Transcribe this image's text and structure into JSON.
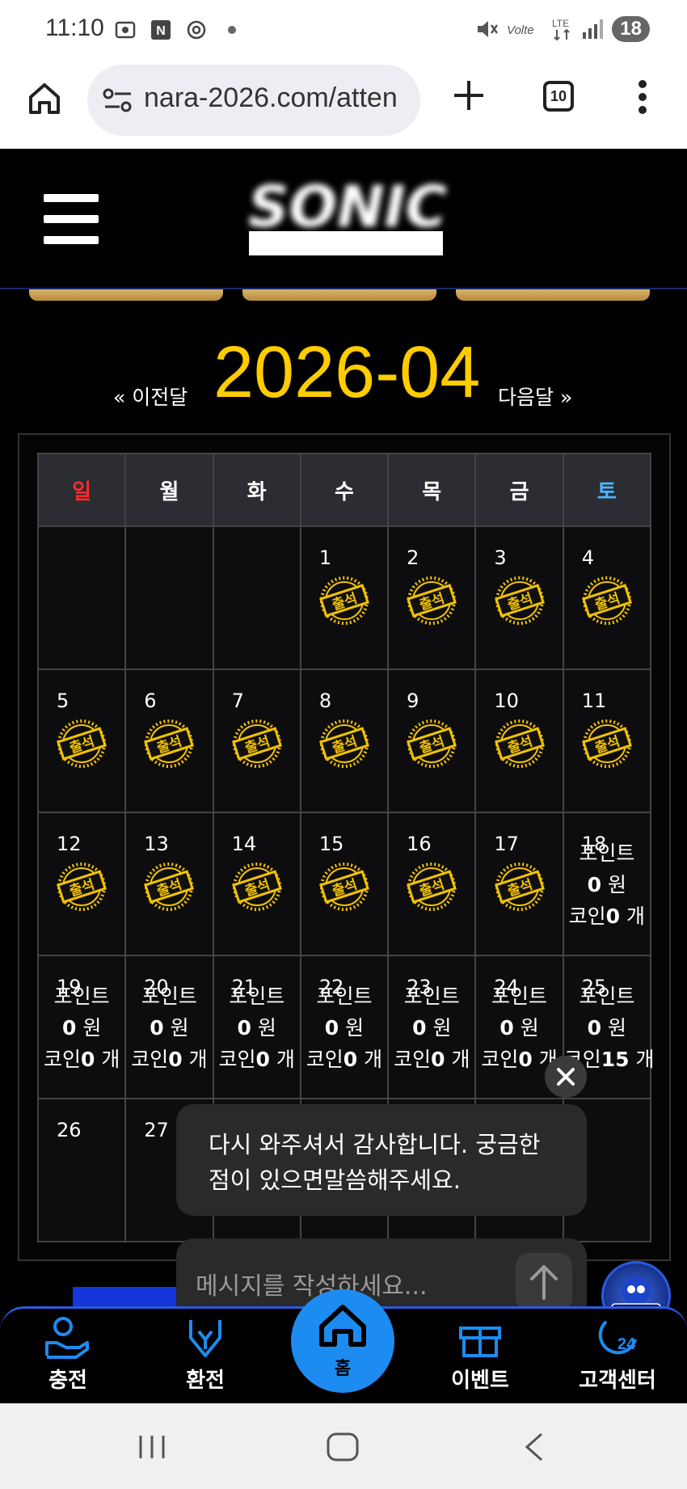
{
  "status_bar": {
    "time": "11:10",
    "battery": "18",
    "network": "LTE"
  },
  "browser": {
    "url": "nara-2026.com/atten",
    "tab_count": "10"
  },
  "calendar": {
    "prev_label": "« 이전달",
    "next_label": "다음달 »",
    "month": "2026-04",
    "weekdays": [
      "일",
      "월",
      "화",
      "수",
      "목",
      "금",
      "토"
    ],
    "sunday_color": "#ff2a2a",
    "saturday_color": "#4fb6ff",
    "stamp_text": "출석",
    "points_label": "포인트",
    "points_unit": "원",
    "coin_label": "코인",
    "coin_unit": "개",
    "days": [
      {
        "day": "1",
        "stamp": true
      },
      {
        "day": "2",
        "stamp": true
      },
      {
        "day": "3",
        "stamp": true
      },
      {
        "day": "4",
        "stamp": true
      },
      {
        "day": "5",
        "stamp": true
      },
      {
        "day": "6",
        "stamp": true
      },
      {
        "day": "7",
        "stamp": true
      },
      {
        "day": "8",
        "stamp": true
      },
      {
        "day": "9",
        "stamp": true
      },
      {
        "day": "10",
        "stamp": true
      },
      {
        "day": "11",
        "stamp": true
      },
      {
        "day": "12",
        "stamp": true
      },
      {
        "day": "13",
        "stamp": true
      },
      {
        "day": "14",
        "stamp": true
      },
      {
        "day": "15",
        "stamp": true
      },
      {
        "day": "16",
        "stamp": true
      },
      {
        "day": "17",
        "stamp": true
      },
      {
        "day": "18",
        "points": "0",
        "coins": "0"
      },
      {
        "day": "19",
        "points": "0",
        "coins": "0"
      },
      {
        "day": "20",
        "points": "0",
        "coins": "0"
      },
      {
        "day": "21",
        "points": "0",
        "coins": "0"
      },
      {
        "day": "22",
        "points": "0",
        "coins": "0"
      },
      {
        "day": "23",
        "points": "0",
        "coins": "0"
      },
      {
        "day": "24",
        "points": "0",
        "coins": "0"
      },
      {
        "day": "25",
        "points": "0",
        "coins": "15"
      },
      {
        "day": "26"
      },
      {
        "day": "27"
      }
    ]
  },
  "chat": {
    "message": "다시 와주셔서 감사합니다. 궁금한점이 있으면말씀해주세요.",
    "placeholder": "메시지를 작성하세요..."
  },
  "bottom_nav": {
    "charge": "충전",
    "exchange": "환전",
    "home": "홈",
    "event": "이벤트",
    "support": "고객센터"
  },
  "icons": {
    "accent_gold": "#ffcc00",
    "nav_blue": "#1d8cf0"
  }
}
